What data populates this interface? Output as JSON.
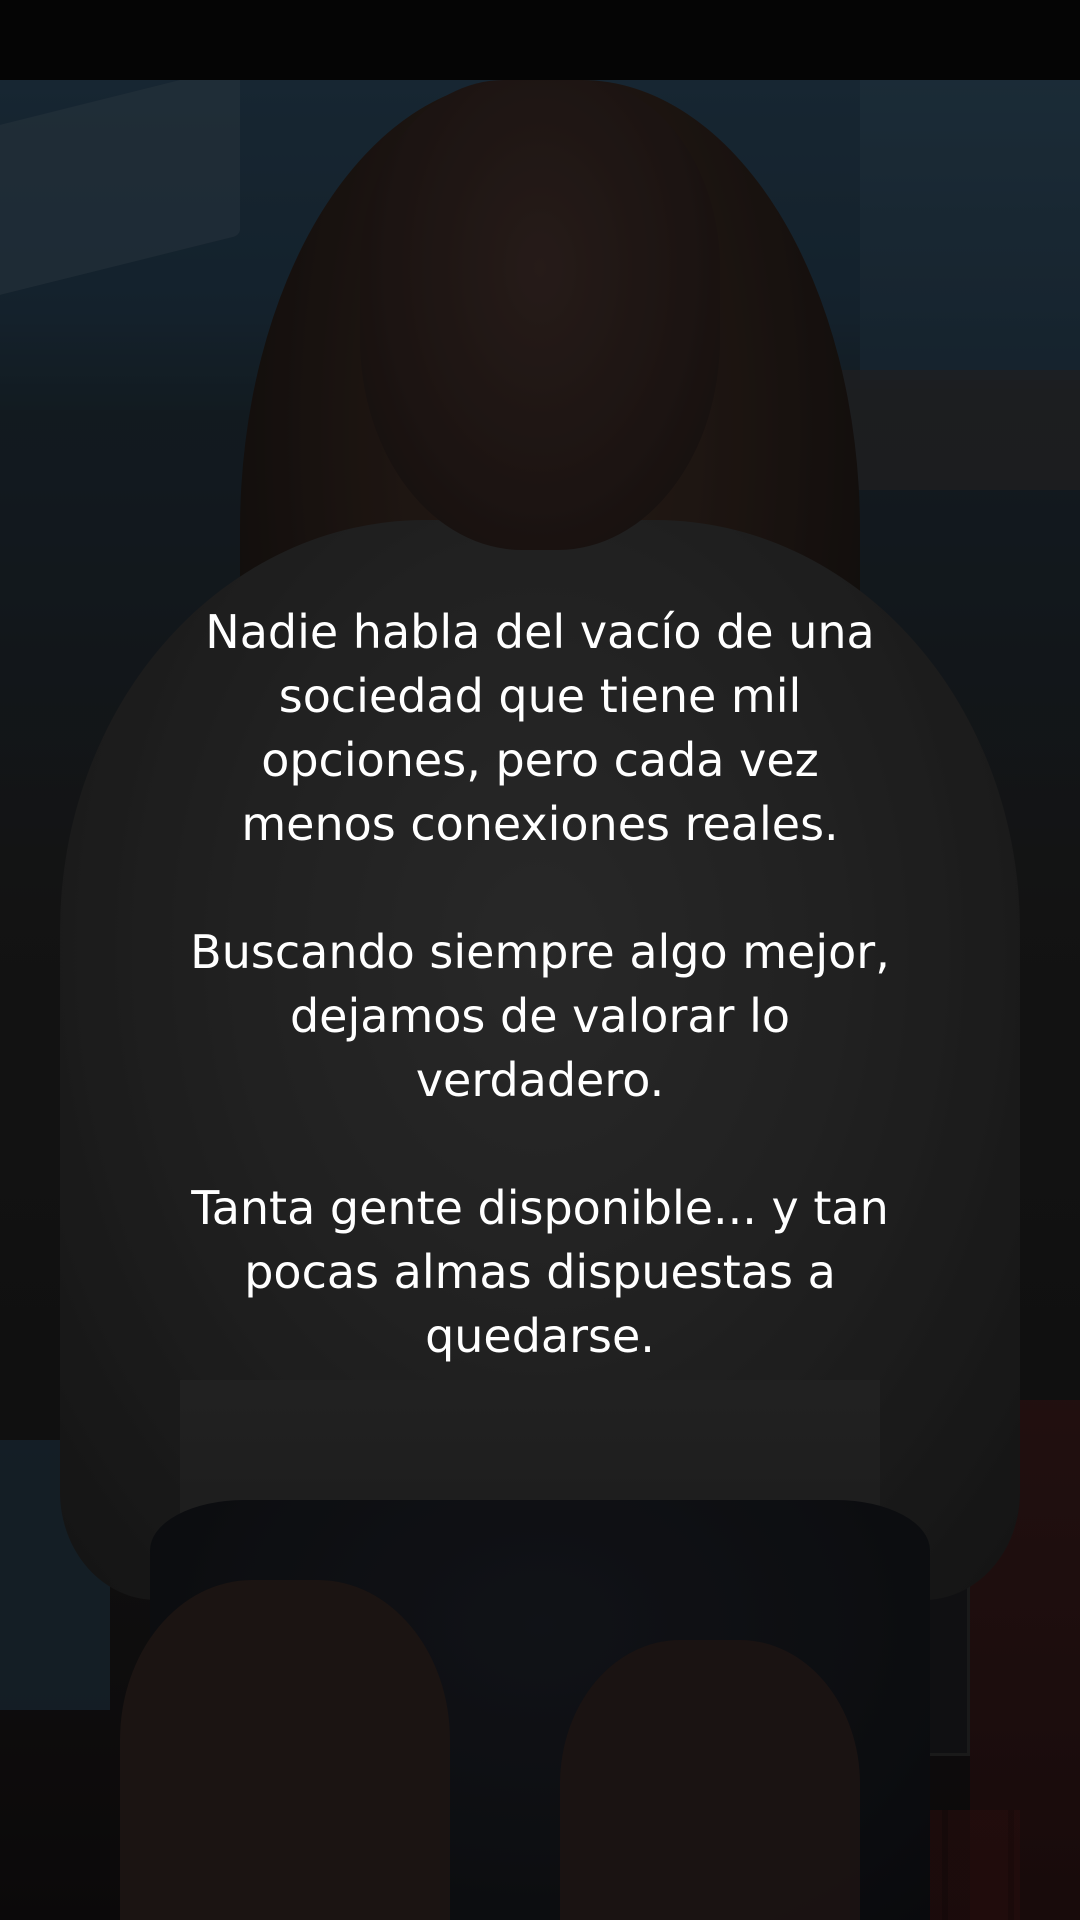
{
  "caption": {
    "paragraphs": [
      {
        "lines": [
          "Nadie habla del vacío de una",
          "sociedad que tiene mil",
          "opciones, pero cada vez",
          "menos conexiones reales."
        ]
      },
      {
        "lines": [
          "Buscando siempre algo mejor,",
          "dejamos de valorar lo",
          "verdadero."
        ]
      },
      {
        "lines": [
          "Tanta gente disponible... y tan",
          "pocas almas dispuestas a",
          "quedarse."
        ]
      }
    ]
  },
  "colors": {
    "caption_text": "#ffffff",
    "top_bar": "#050505"
  }
}
